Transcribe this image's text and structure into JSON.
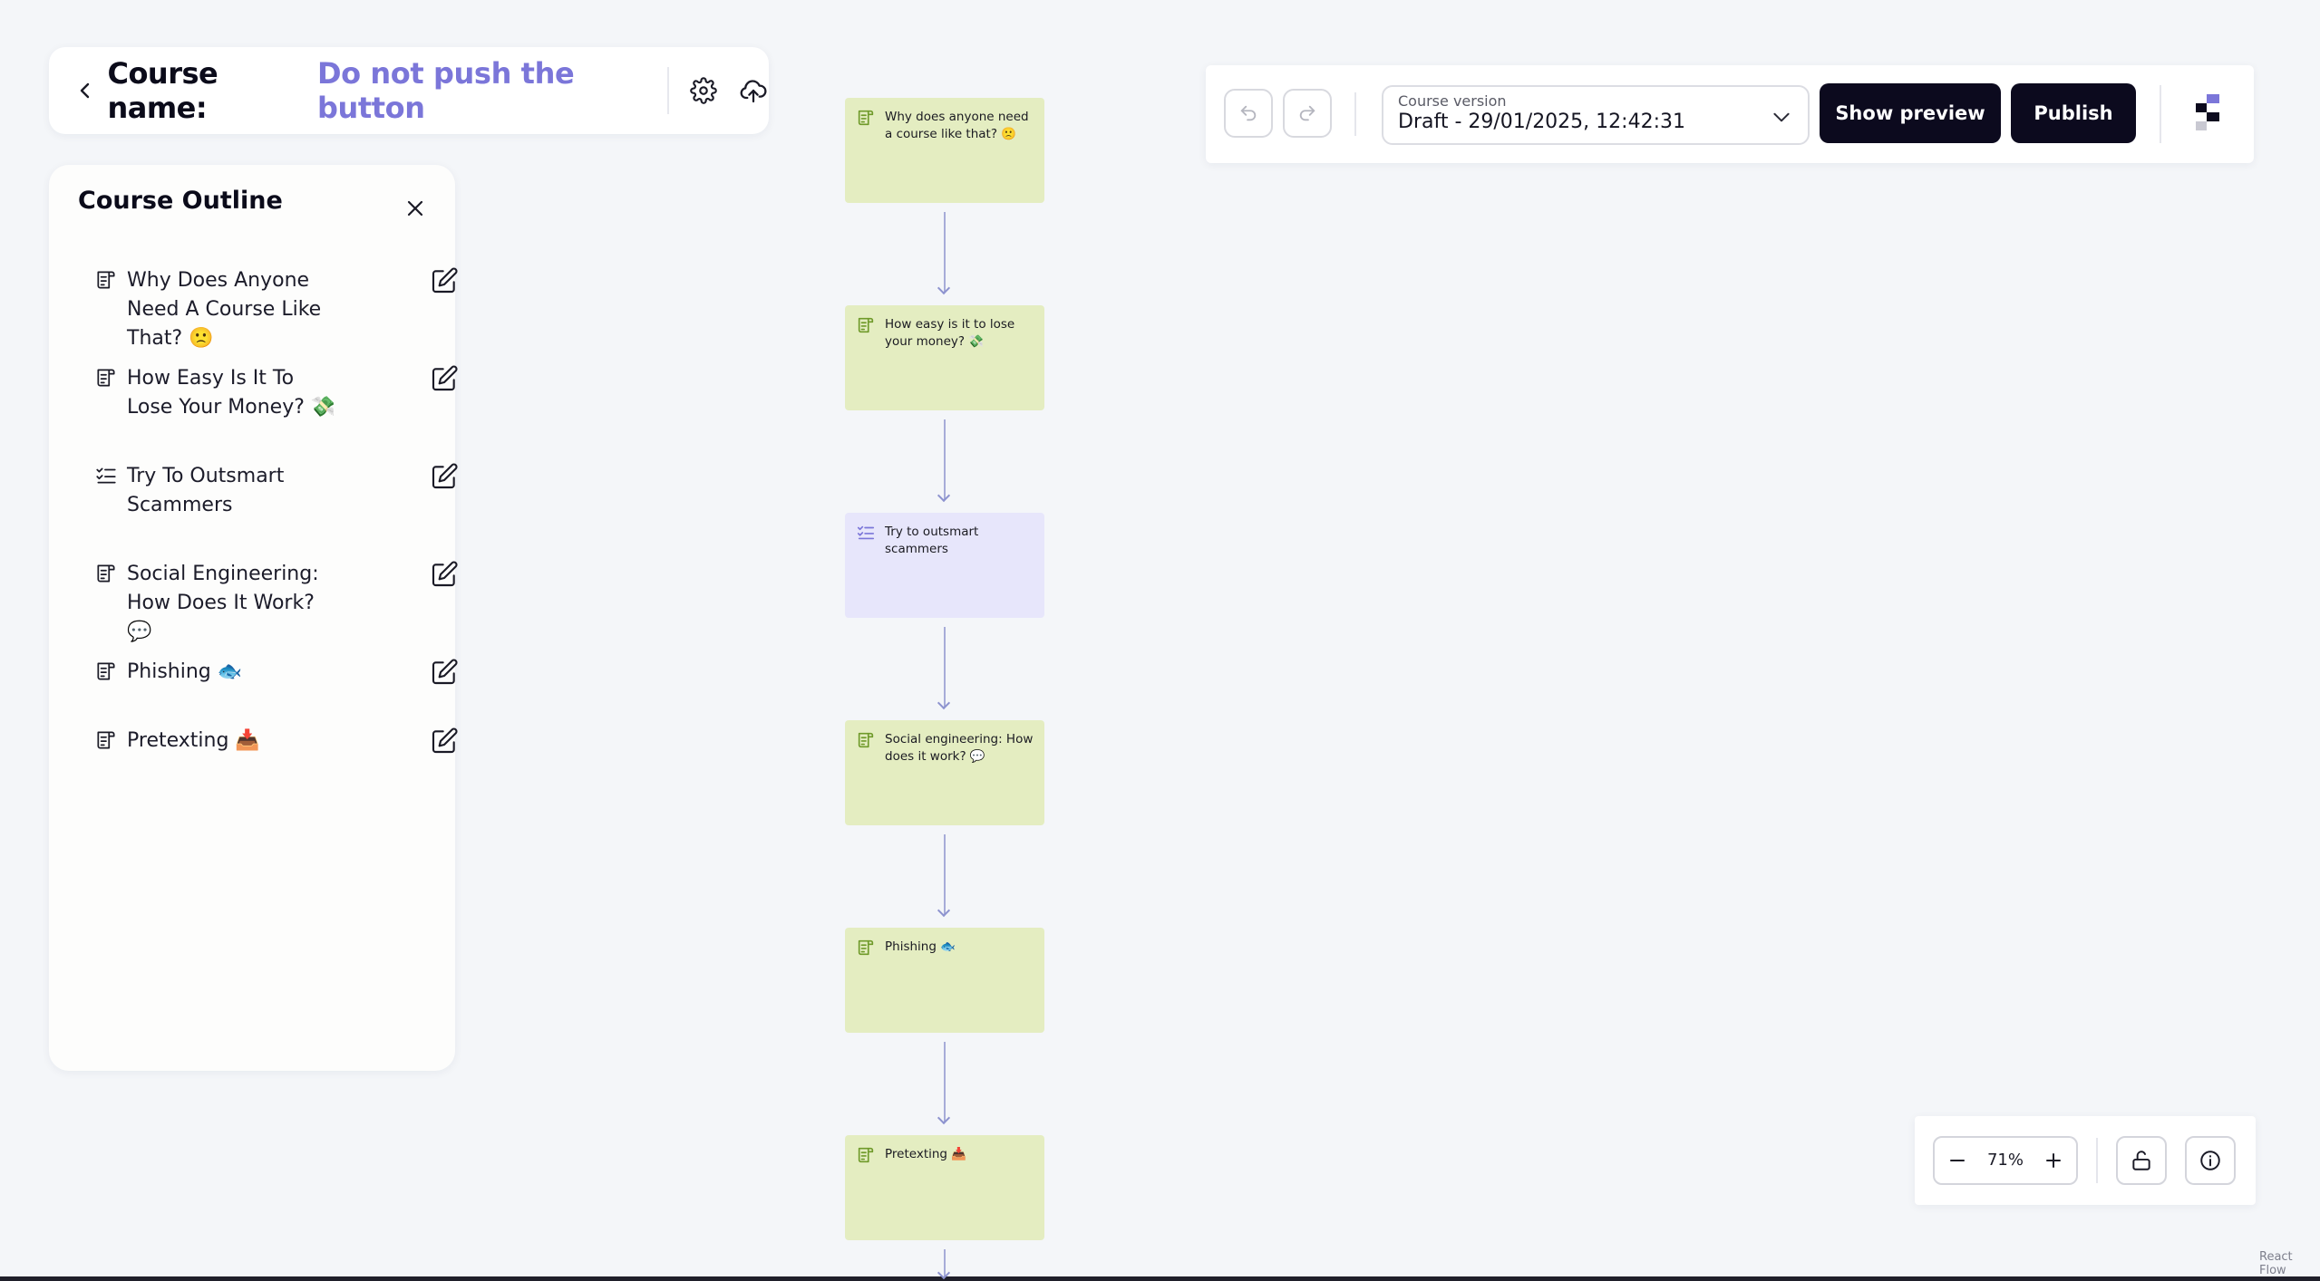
{
  "header": {
    "course_label": "Course name:",
    "course_name": "Do not push the button",
    "icons": {
      "back": "chevron-left-icon",
      "settings": "gear-icon",
      "upload": "cloud-upload-icon"
    }
  },
  "outline": {
    "title": "Course Outline",
    "items": [
      {
        "label": "Why Does Anyone Need A Course Like That? 🙁",
        "type": "lesson"
      },
      {
        "label": "How Easy Is It To Lose Your Money? 💸",
        "type": "lesson"
      },
      {
        "label": "Try To Outsmart Scammers",
        "type": "quiz"
      },
      {
        "label": "Social Engineering: How Does It Work? 💬",
        "type": "lesson"
      },
      {
        "label": "Phishing 🐟",
        "type": "lesson"
      },
      {
        "label": "Pretexting 📥",
        "type": "lesson"
      }
    ]
  },
  "flow": {
    "nodes": [
      {
        "label": "Why does anyone need a course like that? 🙁",
        "type": "lesson"
      },
      {
        "label": "How easy is it to lose your money? 💸",
        "type": "lesson"
      },
      {
        "label": "Try to outsmart scammers",
        "type": "quiz"
      },
      {
        "label": "Social engineering: How does it work? 💬",
        "type": "lesson"
      },
      {
        "label": "Phishing 🐟",
        "type": "lesson"
      },
      {
        "label": "Pretexting 📥",
        "type": "lesson"
      }
    ]
  },
  "toolbar": {
    "version_label": "Course version",
    "version_value": "Draft - 29/01/2025, 12:42:31",
    "preview_label": "Show preview",
    "publish_label": "Publish"
  },
  "controls": {
    "zoom": "71%",
    "attribution": "React Flow"
  },
  "colors": {
    "accent": "#7b76d9",
    "lesson_node": "#e4edc1",
    "quiz_node": "#e7e6fb",
    "button_dark": "#0c0a1e",
    "canvas": "#f4f6f9"
  }
}
